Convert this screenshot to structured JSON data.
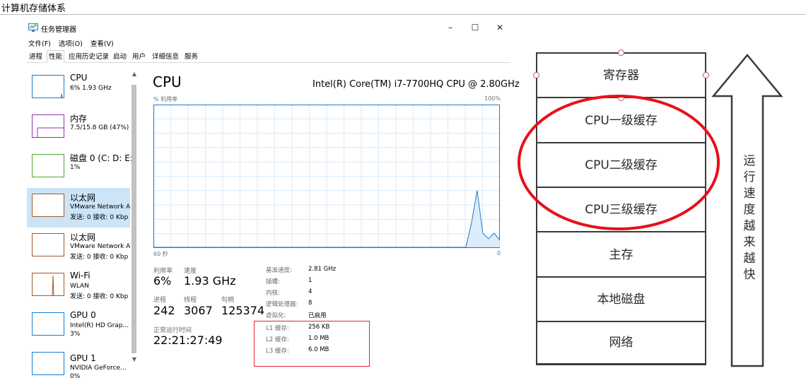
{
  "page_title": "计算机存储体系",
  "task_manager": {
    "window_title": "任务管理器",
    "window_buttons": {
      "minimize": "–",
      "maximize": "☐",
      "close": "✕"
    },
    "menu": [
      "文件(F)",
      "选项(O)",
      "查看(V)"
    ],
    "tabs": [
      "进程",
      "性能",
      "应用历史记录",
      "启动",
      "用户",
      "详细信息",
      "服务"
    ],
    "active_tab": "性能",
    "sidebar": [
      {
        "name": "CPU",
        "sub1": "6% 1.93 GHz",
        "sub2": "",
        "color": "#1a7ccf"
      },
      {
        "name": "内存",
        "sub1": "7.5/15.8 GB (47%)",
        "sub2": "",
        "color": "#9b2fb5"
      },
      {
        "name": "磁盘 0 (C: D: E:",
        "sub1": "1%",
        "sub2": "",
        "color": "#4ca82a"
      },
      {
        "name": "以太网",
        "sub1": "VMware Network A",
        "sub2": "发送: 0 接收: 0 Kbp",
        "color": "#a0592a",
        "selected": true
      },
      {
        "name": "以太网",
        "sub1": "VMware Network A",
        "sub2": "发送: 0 接收: 0 Kbp",
        "color": "#a0592a"
      },
      {
        "name": "Wi-Fi",
        "sub1": "WLAN",
        "sub2": "发送: 0 接收: 0 Kbp",
        "color": "#a0592a"
      },
      {
        "name": "GPU 0",
        "sub1": "Intel(R) HD Grap...",
        "sub2": "3%",
        "color": "#1a7ccf"
      },
      {
        "name": "GPU 1",
        "sub1": "NVIDIA GeForce...",
        "sub2": "0%",
        "color": "#1a7ccf"
      }
    ],
    "cpu_title": "CPU",
    "cpu_model": "Intel(R) Core(TM) i7-7700HQ CPU @ 2.80GHz",
    "graph": {
      "label_usage": "% 利用率",
      "label_max": "100%",
      "label_time": "60 秒",
      "label_min": "0",
      "line_color": "#1a7ccf",
      "usage_series": [
        0,
        0,
        0,
        0,
        0,
        0,
        0,
        0,
        0,
        0,
        0,
        0,
        0,
        0,
        0,
        0,
        0,
        0,
        0,
        0,
        0,
        0,
        0,
        0,
        0,
        0,
        0,
        0,
        0,
        0,
        0,
        0,
        0,
        0,
        0,
        0,
        0,
        0,
        0,
        0,
        0,
        0,
        0,
        0,
        0,
        0,
        0,
        0,
        0,
        0,
        0,
        0,
        0,
        0,
        0,
        0,
        17,
        40,
        10,
        6,
        10,
        5
      ]
    },
    "stats": {
      "usage_label": "利用率",
      "usage_value": "6%",
      "speed_label": "速度",
      "speed_value": "1.93 GHz",
      "processes_label": "进程",
      "processes_value": "242",
      "threads_label": "线程",
      "threads_value": "3067",
      "handles_label": "句柄",
      "handles_value": "125374",
      "uptime_label": "正常运行时间",
      "uptime_value": "22:21:27:49"
    },
    "specs": [
      {
        "key": "基准速度:",
        "value": "2.81 GHz"
      },
      {
        "key": "插槽:",
        "value": "1"
      },
      {
        "key": "内核:",
        "value": "4"
      },
      {
        "key": "逻辑处理器:",
        "value": "8"
      },
      {
        "key": "虚拟化:",
        "value": "已启用"
      },
      {
        "key": "L1 缓存:",
        "value": "256 KB"
      },
      {
        "key": "L2 缓存:",
        "value": "1.0 MB"
      },
      {
        "key": "L3 缓存:",
        "value": "6.0 MB"
      }
    ],
    "highlight_color": "#e0262b"
  },
  "hierarchy": {
    "layers": [
      "寄存器",
      "CPU一级缓存",
      "CPU二级缓存",
      "CPU三级缓存",
      "主存",
      "本地磁盘",
      "网络"
    ],
    "arrow_text": "运行速度越来越快",
    "ellipse_color": "#e8101a"
  }
}
